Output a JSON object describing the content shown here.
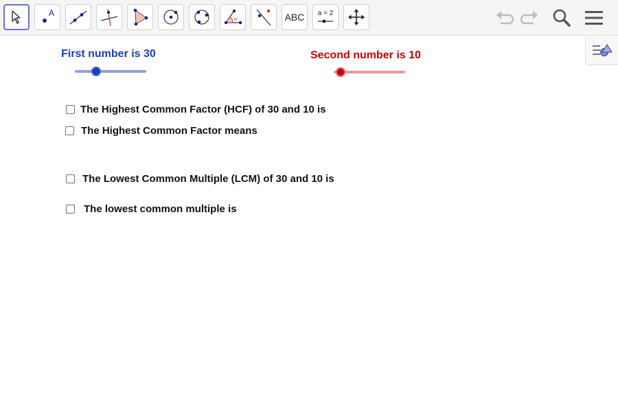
{
  "toolbar": {
    "tools": [
      {
        "name": "move-tool",
        "icon": "arrow-cursor-icon"
      },
      {
        "name": "point-tool",
        "icon": "point-A-icon"
      },
      {
        "name": "line-tool",
        "icon": "line-through-points-icon"
      },
      {
        "name": "perpendicular-line-tool",
        "icon": "perpendicular-line-icon"
      },
      {
        "name": "polygon-tool",
        "icon": "polygon-icon"
      },
      {
        "name": "circle-tool",
        "icon": "circle-center-point-icon"
      },
      {
        "name": "circle-three-points-tool",
        "icon": "circle-three-points-icon"
      },
      {
        "name": "angle-tool",
        "icon": "angle-icon"
      },
      {
        "name": "reflect-tool",
        "icon": "reflect-line-icon"
      },
      {
        "name": "text-tool",
        "icon": "text-icon"
      },
      {
        "name": "slider-tool",
        "icon": "slider-icon"
      },
      {
        "name": "move-graphics-view-tool",
        "icon": "move-arrows-icon"
      }
    ],
    "text_tool_label": "ABC",
    "slider_tool_label": "a = 2"
  },
  "colors": {
    "blue": "#1b3fb5",
    "red": "#cc0000",
    "active_border": "#6e6ed7",
    "icon_blue": "#1c1c8c"
  },
  "sliders": {
    "first": {
      "label": "First number is 30",
      "value": 30,
      "fraction": 0.3
    },
    "second": {
      "label": "Second number is 10",
      "value": 10,
      "fraction": 0.1
    }
  },
  "checkboxes": {
    "hcf": {
      "label": "The Highest Common Factor (HCF) of 30 and 10 is",
      "checked": false
    },
    "hcf_means": {
      "label": "The Highest Common Factor means",
      "checked": false
    },
    "lcm": {
      "label": "The Lowest Common Multiple (LCM) of 30 and 10 is",
      "checked": false
    },
    "lcm_means": {
      "label": "The lowest common multiple is",
      "checked": false
    }
  }
}
